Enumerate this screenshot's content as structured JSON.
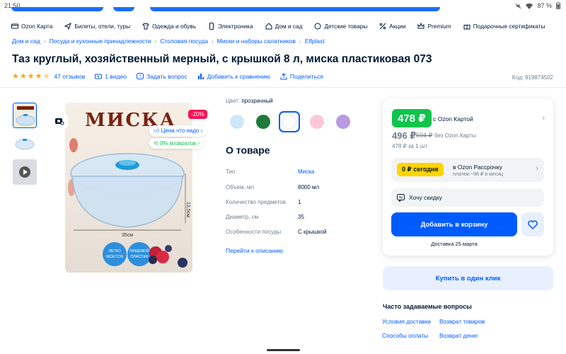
{
  "status": {
    "time": "21:50",
    "battery": "87 %"
  },
  "nav": [
    {
      "label": "Ozon Карта",
      "icon": "card-icon"
    },
    {
      "label": "Билеты, отели, туры",
      "icon": "plane-icon"
    },
    {
      "label": "Одежда и обувь",
      "icon": "clothes-icon"
    },
    {
      "label": "Электроника",
      "icon": "phone-icon"
    },
    {
      "label": "Дом и сад",
      "icon": "home-icon"
    },
    {
      "label": "Детские товары",
      "icon": "baby-icon"
    },
    {
      "label": "Акции",
      "icon": "percent-icon"
    },
    {
      "label": "Premium",
      "icon": "crown-icon"
    },
    {
      "label": "Подарочные сертификаты",
      "icon": "gift-icon"
    }
  ],
  "breadcrumbs": [
    "Дом и сад",
    "Посуда и кухонные принадлежности",
    "Столовая посуда",
    "Миски и наборы салатников",
    "Elfplast"
  ],
  "product": {
    "title": "Таз круглый, хозяйственный мерный, с крышкой 8 л, миска пластиковая 073",
    "reviews": "47 отзывов",
    "videos": "1 видео",
    "ask": "Задать вопрос",
    "compare": "Добавить к сравнению",
    "share": "Поделиться",
    "code": "Код: 919874502",
    "rating": 4.5
  },
  "image": {
    "word": "МИСКА",
    "discount": "-20%",
    "price_tag": "Цена что надо",
    "returns": "0% возвратов"
  },
  "color": {
    "label": "Цвет:",
    "value": "прозрачный",
    "swatches": [
      "#cfe6fb",
      "#1f7a3a",
      "#ffffff",
      "#fcc8d9",
      "#b89ae0"
    ],
    "selected": 2
  },
  "about": {
    "title": "О товаре",
    "specs": [
      {
        "name": "Тип",
        "value": "Миска",
        "link": true
      },
      {
        "name": "Объем, мл",
        "value": "8000 мл",
        "link": false
      },
      {
        "name": "Количество предметов",
        "value": "1",
        "link": false
      },
      {
        "name": "Диаметр, см",
        "value": "35",
        "link": false
      },
      {
        "name": "Особенности посуды",
        "value": "С крышкой",
        "link": false
      }
    ],
    "to_description": "Перейти к описанию"
  },
  "price": {
    "card_price": "478 ₽",
    "card_label": "с Ozon Картой",
    "price": "496 ₽",
    "old_price": "594 ₽",
    "no_card": "без Ozon Карты",
    "unit": "478 ₽ за 1 шт",
    "instal_badge": "0 ₽ сегодня",
    "instal_title": "в Ozon Рассрочку",
    "instal_sub": "платеж ~96 ₽ в месяц",
    "want_discount": "Хочу скидку",
    "add_to_cart": "Добавить в корзину",
    "delivery": "Доставка 25 марта",
    "one_click": "Купить в один клик"
  },
  "faq": {
    "title": "Часто задаваемые вопросы",
    "links": [
      "Условия доставки",
      "Возврат товаров",
      "Способы оплаты",
      "Возврат денег"
    ]
  }
}
